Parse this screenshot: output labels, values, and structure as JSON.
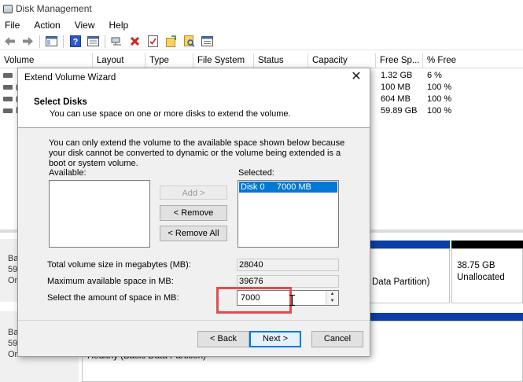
{
  "window": {
    "title": "Disk Management"
  },
  "menu": [
    "File",
    "Action",
    "View",
    "Help"
  ],
  "toolbar_icons": [
    "back-icon",
    "forward-icon",
    "console-tree-icon",
    "help-icon",
    "properties-icon",
    "connect-icon",
    "delete-icon",
    "check-icon",
    "export-icon",
    "search-icon",
    "list-icon"
  ],
  "columns": [
    "Volume",
    "Layout",
    "Type",
    "File System",
    "Status",
    "Capacity",
    "Free Sp...",
    "% Free"
  ],
  "volumes": [
    {
      "name": "",
      "free": "1.32 GB",
      "pct": "6 %"
    },
    {
      "name": "(",
      "free": "100 MB",
      "pct": "100 %"
    },
    {
      "name": "(",
      "free": "604 MB",
      "pct": "100 %"
    },
    {
      "name": "N",
      "free": "59.89 GB",
      "pct": "100 %"
    }
  ],
  "disk0": {
    "line1": "Ba",
    "line2": "59.",
    "line3": "On",
    "partition_text": "Data Partition)",
    "unalloc_size": "38.75 GB",
    "unalloc_label": "Unallocated"
  },
  "disk1": {
    "line1": "Ba",
    "line2": "59.",
    "line3": "Online",
    "partition_text": "Healthy (Basic Data Partition)"
  },
  "wizard": {
    "title": "Extend Volume Wizard",
    "heading": "Select Disks",
    "subheading": "You can use space on one or more disks to extend the volume.",
    "explanation": "You can only extend the volume to the available space shown below because your disk cannot be converted to dynamic or the volume being extended is a boot or system volume.",
    "available_label": "Available:",
    "selected_label": "Selected:",
    "selected_item": "Disk 0     7000 MB",
    "add_button": "Add >",
    "remove_button": "< Remove",
    "remove_all_button": "< Remove All",
    "total_label": "Total volume size in megabytes (MB):",
    "total_value": "28040",
    "max_label": "Maximum available space in MB:",
    "max_value": "39676",
    "amount_label": "Select the amount of space in MB:",
    "amount_value": "7000",
    "back_button": "< Back",
    "next_button": "Next >",
    "cancel_button": "Cancel"
  }
}
